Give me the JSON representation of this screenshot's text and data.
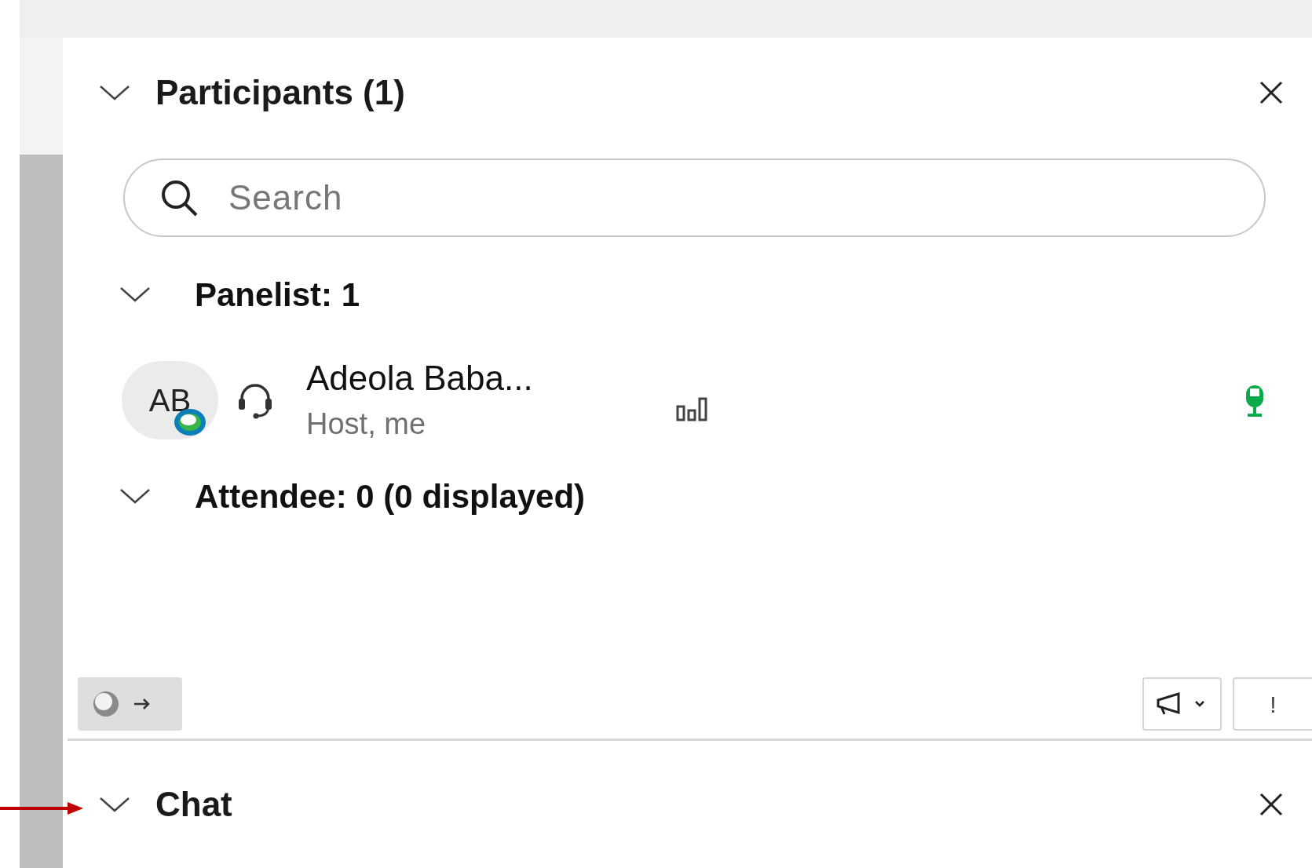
{
  "participants": {
    "title": "Participants (1)",
    "expanded": true
  },
  "search": {
    "placeholder": "Search"
  },
  "groups": [
    {
      "label": "Panelist: 1",
      "expanded": true,
      "members": [
        {
          "initials": "AB",
          "name": "Adeola Baba...",
          "role": "Host, me",
          "muted": false
        }
      ]
    },
    {
      "label": "Attendee: 0 (0 displayed)",
      "expanded": true
    }
  ],
  "toolbar": {
    "alert_button": "!"
  },
  "chat": {
    "title": "Chat",
    "expanded": true
  }
}
